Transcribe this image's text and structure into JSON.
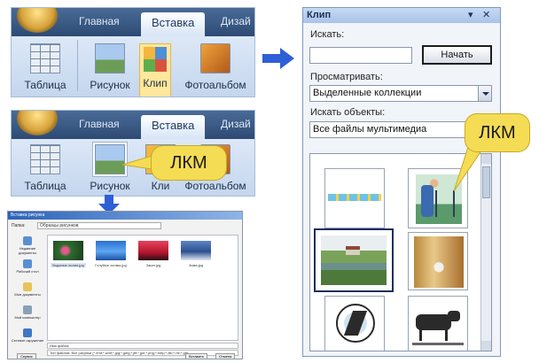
{
  "ribbon_top": {
    "tabs": [
      "Главная",
      "Вставка",
      "Дизай"
    ],
    "buttons": [
      "Таблица",
      "Рисунок",
      "Клип",
      "Фотоальбом"
    ]
  },
  "ribbon_bottom": {
    "tabs": [
      "Главная",
      "Вставка",
      "Дизай"
    ],
    "buttons": [
      "Таблица",
      "Рисунок",
      "Кли",
      "Фотоальбом"
    ],
    "callout": "ЛКМ"
  },
  "insert_picture_dialog": {
    "title": "Вставка рисунка",
    "folder_label": "Папка:",
    "folder_value": "Образцы рисунков",
    "places": [
      "Недавние документы",
      "Рабочий стол",
      "Мои документы",
      "Мой компьютер",
      "Сетевое окружение"
    ],
    "files": [
      "Водяные лилии.jpg",
      "Голубые холмы.jpg",
      "Закат.jpg",
      "Зима.jpg"
    ],
    "filename_label": "Имя файла:",
    "filetype_label": "Тип файлов:",
    "filetype_value": "Все рисунки (*.emf;*.wmf;*.jpg;*.jpeg;*.jfif;*.jpe;*.png;*.bmp;*.dib;*.rle;*.gif)",
    "buttons": [
      "Сервис",
      "Вставить",
      "Отмена"
    ]
  },
  "clip_panel": {
    "title": "Клип",
    "search_label": "Искать:",
    "search_value": "",
    "start_button": "Начать",
    "browse_label": "Просматривать:",
    "browse_value": "Выделенные коллекции",
    "types_label": "Искать объекты:",
    "types_value": "Все файлы мультимедиа",
    "callout": "ЛКМ",
    "clip_items": [
      "border-strip",
      "man-with-camera",
      "lake-landscape",
      "autumn-park",
      "runner",
      "cow"
    ]
  },
  "colors": {
    "ribbon": "#c9d9ef",
    "callout": "#f4dc55",
    "arrow": "#2f5fd6",
    "panel_title": "#a9c3e8"
  },
  "icons": [
    "office-button-icon",
    "table-icon",
    "picture-icon",
    "clipart-icon",
    "photo-album-icon",
    "arrow-right-icon",
    "arrow-down-icon",
    "dropdown-arrow-icon",
    "close-icon"
  ]
}
